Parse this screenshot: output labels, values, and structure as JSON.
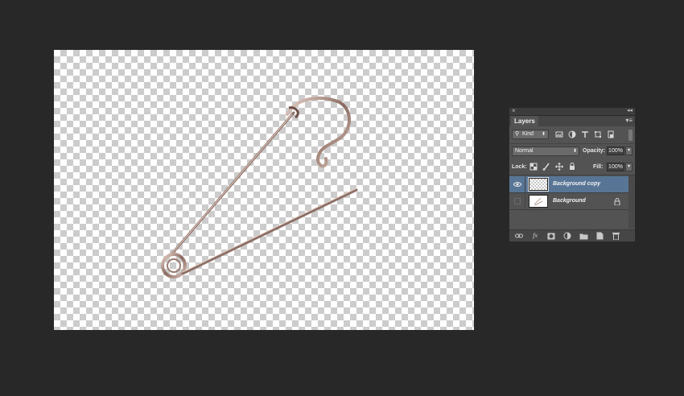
{
  "document": {
    "canvas_background": "transparent-checkerboard",
    "subject_icon": "safety-pin-image"
  },
  "layers_panel": {
    "close_glyph": "×",
    "collapse_glyph": "◂◂",
    "tab_label": "Layers",
    "menu_glyph": "▾≡",
    "filter": {
      "search_glyph": "⚲",
      "kind_label": "Kind",
      "arrow_glyph": "⬍",
      "icons": [
        "image-filter-icon",
        "adjustment-filter-icon",
        "type-filter-icon",
        "shape-filter-icon",
        "smart-object-filter-icon"
      ]
    },
    "blend_mode": "Normal",
    "opacity_label": "Opacity:",
    "opacity_value": "100%",
    "lock_label": "Lock:",
    "fill_label": "Fill:",
    "fill_value": "100%",
    "dropdown_glyph": "▾",
    "layers": [
      {
        "name": "Background copy",
        "visible": true,
        "selected": true,
        "locked": false
      },
      {
        "name": "Background",
        "visible": false,
        "selected": false,
        "locked": true
      }
    ],
    "footer_icons": [
      "link-layers-icon",
      "fx-icon",
      "add-mask-icon",
      "adjustment-layer-icon",
      "new-group-icon",
      "new-layer-icon",
      "delete-layer-icon"
    ],
    "fx_label": "fx"
  }
}
